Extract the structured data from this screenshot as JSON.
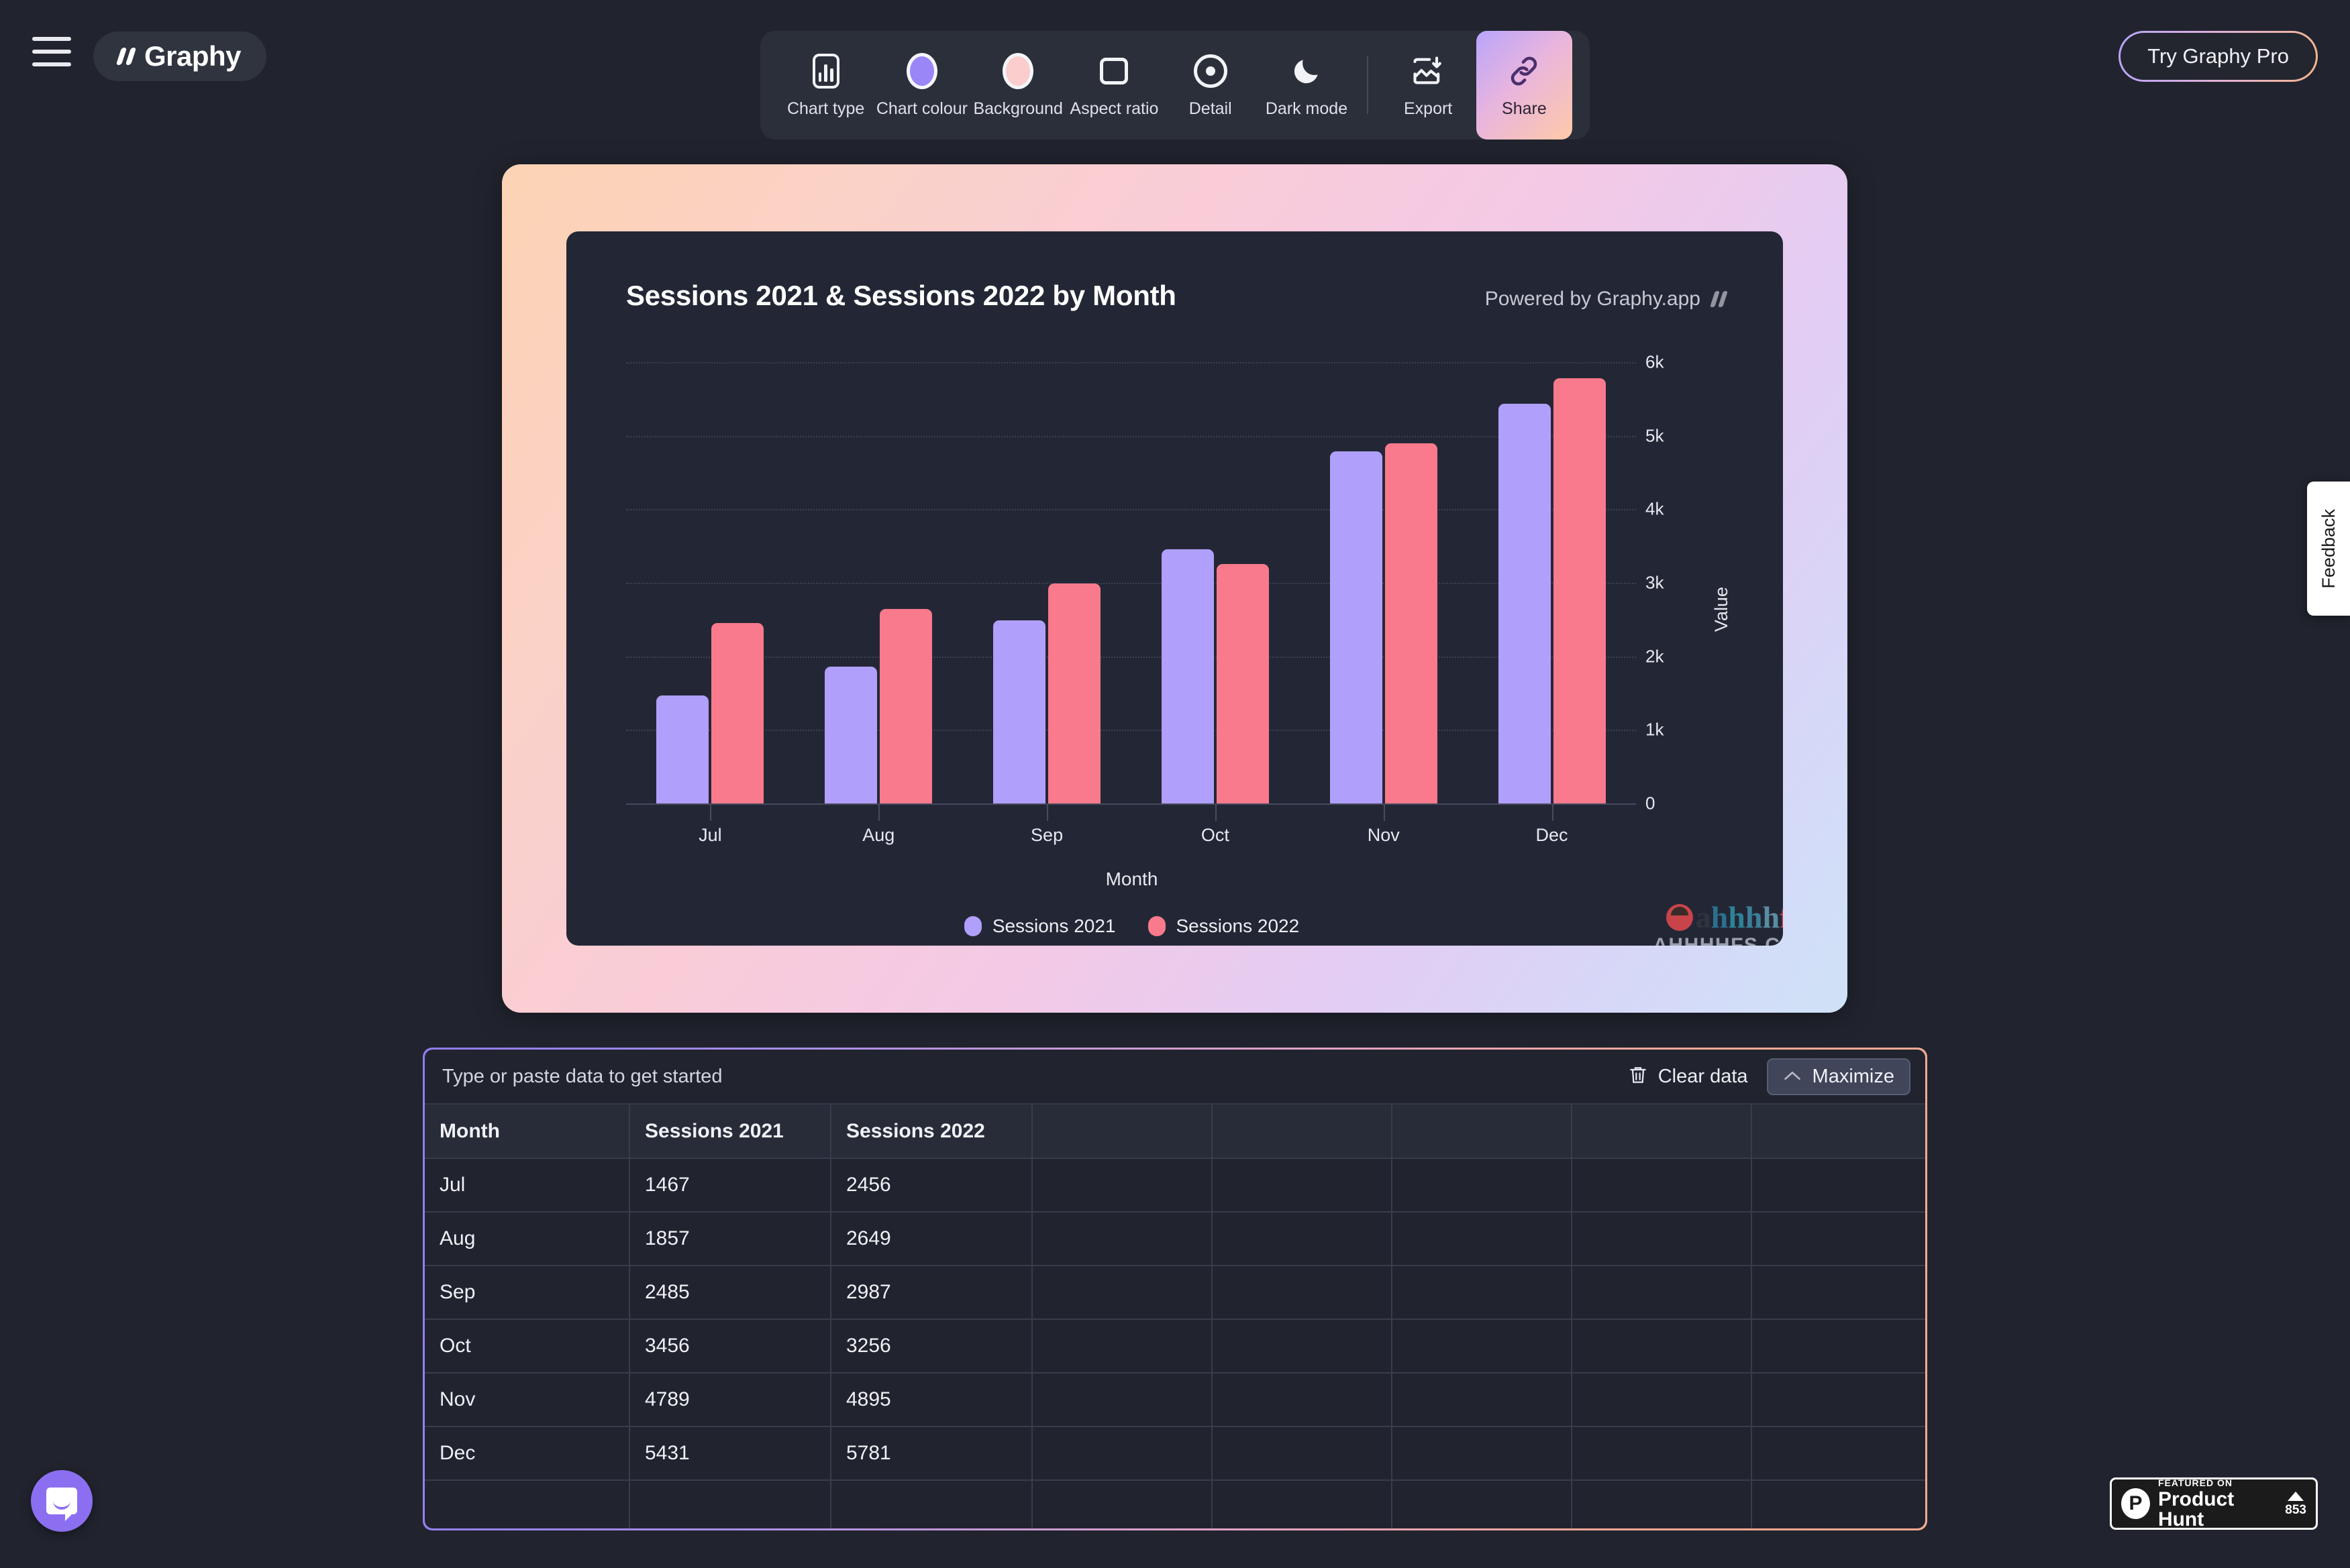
{
  "header": {
    "menu_icon": "hamburger-icon",
    "brand": "Graphy",
    "try_pro_label": "Try Graphy Pro"
  },
  "toolbar": {
    "items": [
      {
        "label": "Chart type",
        "icon": "bar-chart-icon",
        "active": false
      },
      {
        "label": "Chart colour",
        "icon": "colour-circle-icon",
        "active": false
      },
      {
        "label": "Background",
        "icon": "background-circle-icon",
        "active": false
      },
      {
        "label": "Aspect ratio",
        "icon": "rectangle-icon",
        "active": false
      },
      {
        "label": "Detail",
        "icon": "target-icon",
        "active": false
      },
      {
        "label": "Dark mode",
        "icon": "moon-icon",
        "active": false
      },
      {
        "label": "Export",
        "icon": "export-image-icon",
        "active": false
      },
      {
        "label": "Share",
        "icon": "link-icon",
        "active": true
      }
    ]
  },
  "chart_card": {
    "title": "Sessions 2021 & Sessions 2022 by Month",
    "powered_by": "Powered by Graphy.app",
    "watermark_text": "ahhhhfs",
    "watermark_domain": "AHHHHFS.COM"
  },
  "chart_data": {
    "type": "bar",
    "title": "Sessions 2021 & Sessions 2022 by Month",
    "xlabel": "Month",
    "ylabel": "Value",
    "categories": [
      "Jul",
      "Aug",
      "Sep",
      "Oct",
      "Nov",
      "Dec"
    ],
    "series": [
      {
        "name": "Sessions 2021",
        "color": "#b0a0fb",
        "values": [
          1467,
          1857,
          2485,
          3456,
          4789,
          5431
        ]
      },
      {
        "name": "Sessions 2022",
        "color": "#f97a8c",
        "values": [
          2456,
          2649,
          2987,
          3256,
          4895,
          5781
        ]
      }
    ],
    "ylim": [
      0,
      6000
    ],
    "yticks": [
      0,
      1000,
      2000,
      3000,
      4000,
      5000,
      6000
    ],
    "ytick_labels": [
      "0",
      "1k",
      "2k",
      "3k",
      "4k",
      "5k",
      "6k"
    ],
    "grid": true,
    "legend_position": "bottom"
  },
  "data_panel": {
    "hint": "Type or paste data to get started",
    "clear_label": "Clear data",
    "maximize_label": "Maximize",
    "columns": [
      "Month",
      "Sessions 2021",
      "Sessions 2022",
      "",
      "",
      "",
      "",
      ""
    ],
    "rows": [
      [
        "Jul",
        "1467",
        "2456",
        "",
        "",
        "",
        "",
        ""
      ],
      [
        "Aug",
        "1857",
        "2649",
        "",
        "",
        "",
        "",
        ""
      ],
      [
        "Sep",
        "2485",
        "2987",
        "",
        "",
        "",
        "",
        ""
      ],
      [
        "Oct",
        "3456",
        "3256",
        "",
        "",
        "",
        "",
        ""
      ],
      [
        "Nov",
        "4789",
        "4895",
        "",
        "",
        "",
        "",
        ""
      ],
      [
        "Dec",
        "5431",
        "5781",
        "",
        "",
        "",
        "",
        ""
      ],
      [
        "",
        "",
        "",
        "",
        "",
        "",
        "",
        ""
      ]
    ]
  },
  "chrome": {
    "feedback_label": "Feedback",
    "product_hunt": {
      "featured_on": "FEATURED ON",
      "name": "Product Hunt",
      "votes": "853"
    }
  },
  "colors": {
    "series_1": "#b0a0fb",
    "series_2": "#f97a8c",
    "page_bg": "#21242e",
    "card_bg": "#232735",
    "accent": "#8c6ff0"
  }
}
